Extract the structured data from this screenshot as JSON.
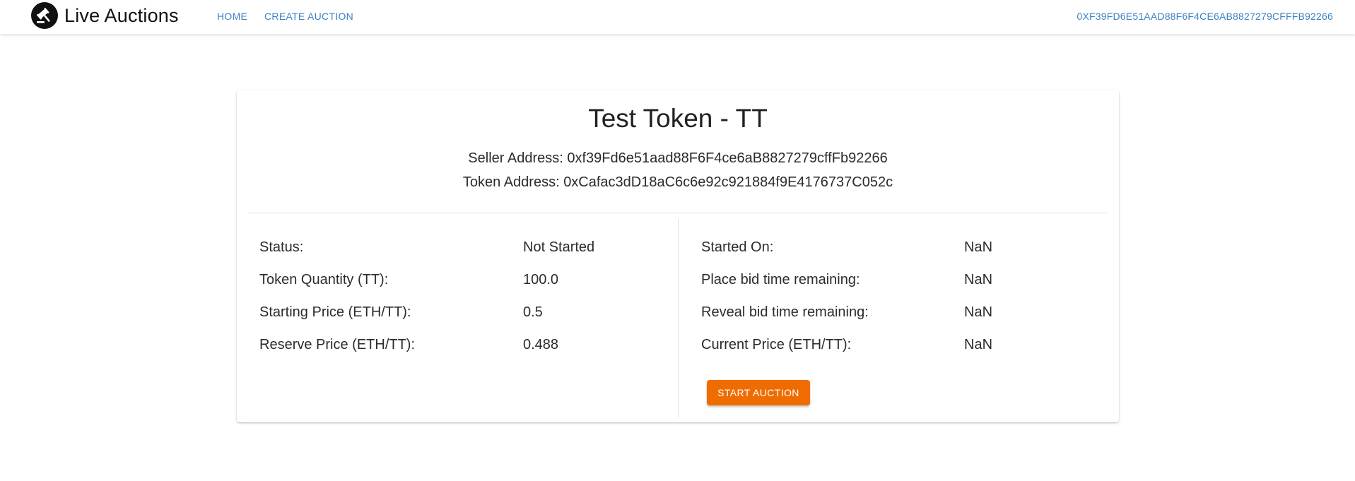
{
  "navbar": {
    "brand": "Live Auctions",
    "links": [
      "HOME",
      "CREATE AUCTION"
    ],
    "account": "0XF39FD6E51AAD88F6F4CE6AB8827279CFFFB92266"
  },
  "auction": {
    "title": "Test Token - TT",
    "seller_label": "Seller Address:",
    "seller_address": "0xf39Fd6e51aad88F6F4ce6aB8827279cffFb92266",
    "token_label": "Token Address:",
    "token_address": "0xCafac3dD18aC6c6e92c921884f9E4176737C052c",
    "left_fields": [
      {
        "label": "Status:",
        "value": "Not Started"
      },
      {
        "label": "Token Quantity (TT):",
        "value": "100.0"
      },
      {
        "label": "Starting Price (ETH/TT):",
        "value": "0.5"
      },
      {
        "label": "Reserve Price (ETH/TT):",
        "value": "0.488"
      }
    ],
    "right_fields": [
      {
        "label": "Started On:",
        "value": "NaN"
      },
      {
        "label": "Place bid time remaining:",
        "value": "NaN"
      },
      {
        "label": "Reveal bid time remaining:",
        "value": "NaN"
      },
      {
        "label": "Current Price (ETH/TT):",
        "value": "NaN"
      }
    ],
    "start_button": "START AUCTION"
  },
  "icons": {
    "logo": "gavel-icon"
  },
  "colors": {
    "link": "#3b82c4",
    "accent_button": "#ef6c00",
    "text": "#212121"
  }
}
